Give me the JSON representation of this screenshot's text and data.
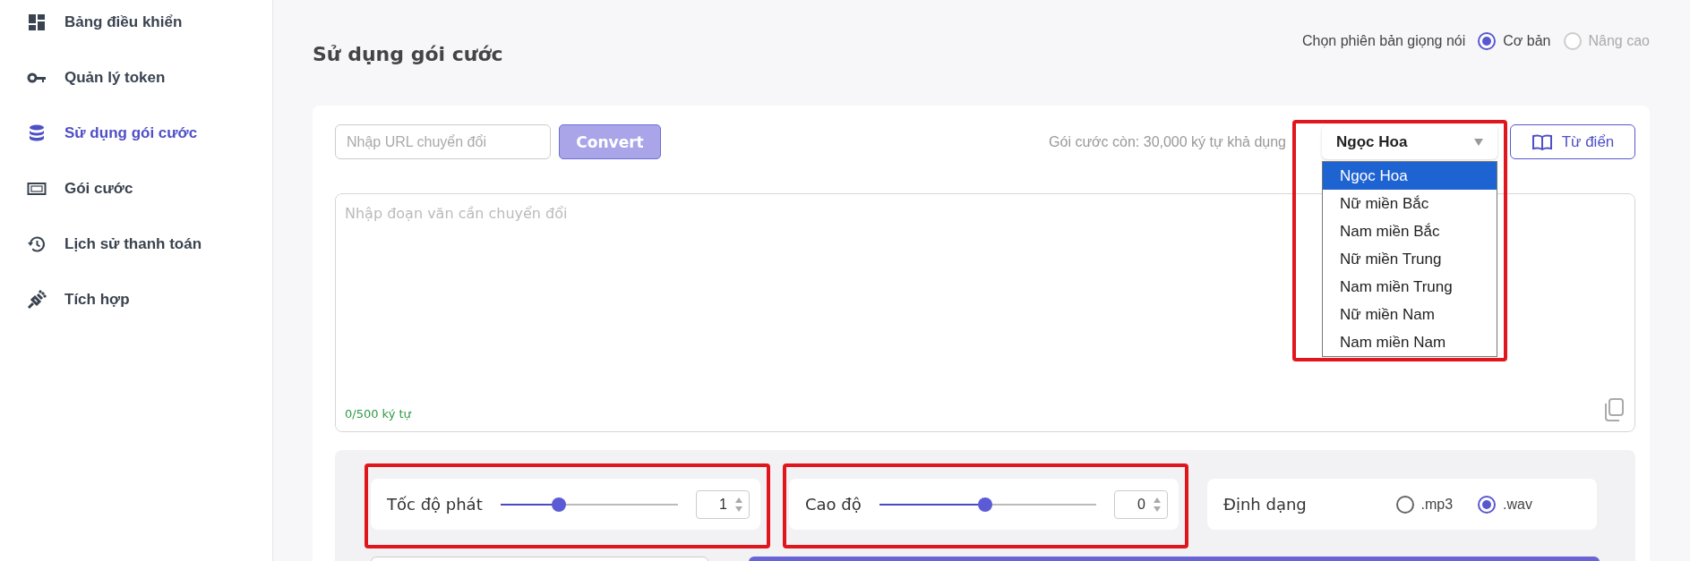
{
  "sidebar": {
    "items": [
      {
        "label": "Bảng điều khiển",
        "selected": false
      },
      {
        "label": "Quản lý token",
        "selected": false
      },
      {
        "label": "Sử dụng gói cước",
        "selected": true
      },
      {
        "label": "Gói cước",
        "selected": false
      },
      {
        "label": "Lịch sử thanh toán",
        "selected": false
      },
      {
        "label": "Tích hợp",
        "selected": false
      }
    ]
  },
  "header": {
    "title": "Sử dụng gói cước",
    "voice_version": {
      "label": "Chọn phiên bản giọng nói",
      "options": [
        {
          "label": "Cơ bản",
          "selected": true,
          "disabled": false
        },
        {
          "label": "Nâng cao",
          "selected": false,
          "disabled": true
        }
      ]
    }
  },
  "converter": {
    "url_field": {
      "placeholder": "Nhập URL chuyển đổi"
    },
    "convert_button": {
      "label": "Convert",
      "disabled": true
    },
    "quota": "Gói cước còn: 30,000 ký tự khả dụng",
    "voice_select": {
      "value": "Ngọc Hoa",
      "highlighted": true,
      "expanded": true,
      "options": [
        {
          "label": "Ngọc Hoa",
          "selected": true
        },
        {
          "label": "Nữ miền Bắc",
          "selected": false
        },
        {
          "label": "Nam miền Bắc",
          "selected": false
        },
        {
          "label": "Nữ miền Trung",
          "selected": false
        },
        {
          "label": "Nam miền Trung",
          "selected": false
        },
        {
          "label": "Nữ miền Nam",
          "selected": false
        },
        {
          "label": "Nam miền Nam",
          "selected": false
        }
      ]
    },
    "dictionary_button": "Từ điển",
    "text_area": {
      "placeholder": "Nhập đoạn văn cần chuyển đổi",
      "counter": "0/500 ký tự"
    }
  },
  "settings": [
    {
      "kind": "slider",
      "label": "Tốc độ phát",
      "level": 0.33,
      "value": "1",
      "highlighted": true
    },
    {
      "kind": "slider",
      "label": "Cao độ",
      "level": 0.49,
      "value": "0",
      "highlighted": true
    },
    {
      "kind": "radio",
      "label": "Định dạng",
      "options": [
        {
          "label": ".mp3",
          "selected": false
        },
        {
          "label": ".wav",
          "selected": true
        }
      ]
    }
  ]
}
